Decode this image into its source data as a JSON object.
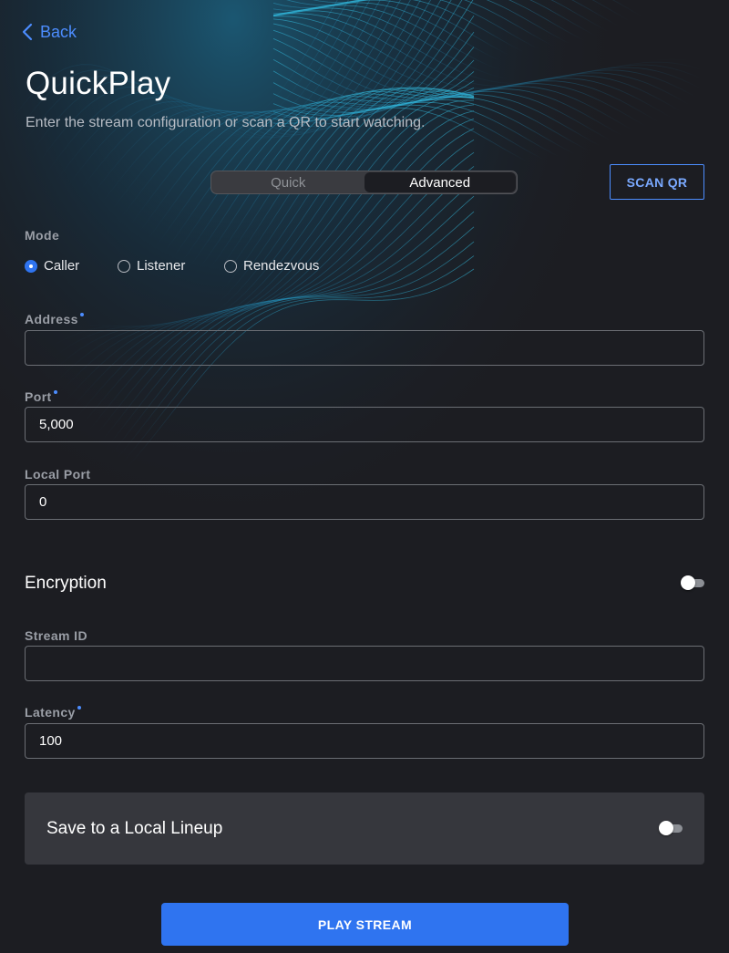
{
  "header": {
    "back_label": "Back",
    "title": "QuickPlay",
    "subtitle": "Enter the stream configuration or scan a QR to start watching."
  },
  "segmented": {
    "options": [
      "Quick",
      "Advanced"
    ],
    "selected": "Advanced"
  },
  "scan_button": "SCAN QR",
  "mode": {
    "label": "Mode",
    "options": [
      "Caller",
      "Listener",
      "Rendezvous"
    ],
    "selected": "Caller"
  },
  "fields": {
    "address": {
      "label": "Address",
      "value": "",
      "required": true
    },
    "port": {
      "label": "Port",
      "value": "5,000",
      "required": true
    },
    "local_port": {
      "label": "Local Port",
      "value": "0",
      "required": false
    },
    "stream_id": {
      "label": "Stream ID",
      "value": "",
      "required": false
    },
    "latency": {
      "label": "Latency",
      "value": "100",
      "required": true
    }
  },
  "encryption": {
    "label": "Encryption",
    "enabled": false
  },
  "save_lineup": {
    "label": "Save to a Local Lineup",
    "enabled": false
  },
  "play_button": "PLAY STREAM",
  "colors": {
    "accent": "#2f74f0",
    "link": "#4c8dff",
    "background": "#1c1d22",
    "card": "#36373d"
  },
  "icons": {
    "back": "chevron-left-icon"
  }
}
